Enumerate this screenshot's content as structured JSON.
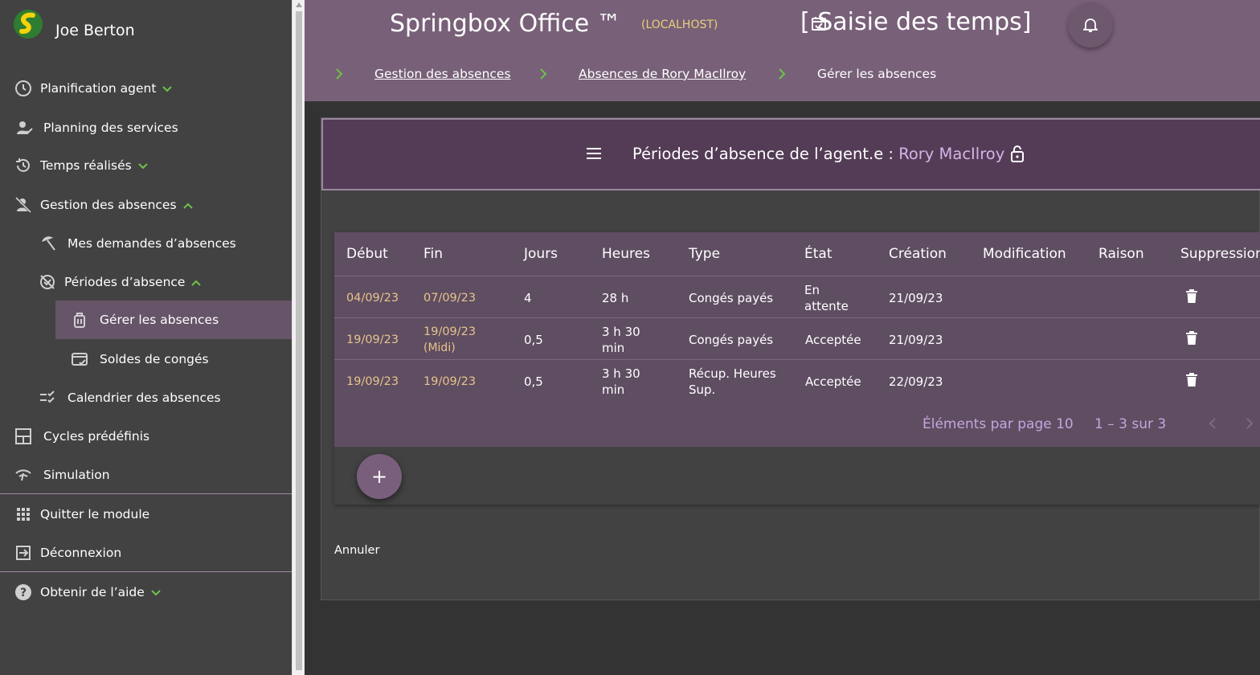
{
  "user": {
    "name": "Joe Berton"
  },
  "sidebar": {
    "items": [
      {
        "label": "Planification agent"
      },
      {
        "label": "Planning des services"
      },
      {
        "label": "Temps réalisés"
      },
      {
        "label": "Gestion des absences"
      },
      {
        "label": "Mes demandes d’absences"
      },
      {
        "label": "Périodes d’absence"
      },
      {
        "label": "Gérer les absences"
      },
      {
        "label": "Soldes de congés"
      },
      {
        "label": "Calendrier des absences"
      },
      {
        "label": "Cycles prédéfinis"
      },
      {
        "label": "Simulation"
      },
      {
        "label": "Quitter le module"
      },
      {
        "label": "Déconnexion"
      },
      {
        "label": "Obtenir de l’aide"
      }
    ]
  },
  "header": {
    "app_title": "Springbox Office ™",
    "host": "(LOCALHOST)",
    "page_title": "[ Saisie des temps]",
    "breadcrumb": [
      "Gestion des absences",
      "Absences de Rory MacIlroy",
      "Gérer les absences"
    ]
  },
  "card": {
    "title_prefix": "Périodes d’absence de l’agent.e : ",
    "agent_name": "Rory MacIlroy"
  },
  "table": {
    "columns": [
      "Début",
      "Fin",
      "Jours",
      "Heures",
      "Type",
      "État",
      "Création",
      "Modification",
      "Raison",
      "Suppression"
    ],
    "rows": [
      {
        "debut": "04/09/23",
        "fin": "07/09/23",
        "fin_note": "",
        "jours": "4",
        "heures_1": "28 h",
        "heures_2": "",
        "type_1": "Congés payés",
        "type_2": "",
        "etat_1": "En",
        "etat_2": "attente",
        "creation": "21/09/23",
        "modification": "",
        "raison": ""
      },
      {
        "debut": "19/09/23",
        "fin": "19/09/23",
        "fin_note": "(Midi)",
        "jours": "0,5",
        "heures_1": "3 h 30",
        "heures_2": "min",
        "type_1": "Congés payés",
        "type_2": "",
        "etat_1": "Acceptée",
        "etat_2": "",
        "creation": "21/09/23",
        "modification": "",
        "raison": ""
      },
      {
        "debut": "19/09/23",
        "fin": "19/09/23",
        "fin_note": "",
        "jours": "0,5",
        "heures_1": "3 h 30",
        "heures_2": "min",
        "type_1": "Récup. Heures",
        "type_2": "Sup.",
        "etat_1": "Acceptée",
        "etat_2": "",
        "creation": "22/09/23",
        "modification": "",
        "raison": ""
      }
    ],
    "items_per_page_label": "Éléments par page",
    "items_per_page": "10",
    "range": "1 – 3 sur 3"
  },
  "actions": {
    "add": "+",
    "cancel": "Annuler"
  },
  "colors": {
    "accent": "#786078",
    "sidebar": "#424242",
    "date": "#e8c48a",
    "chevron": "#6cc24a"
  }
}
